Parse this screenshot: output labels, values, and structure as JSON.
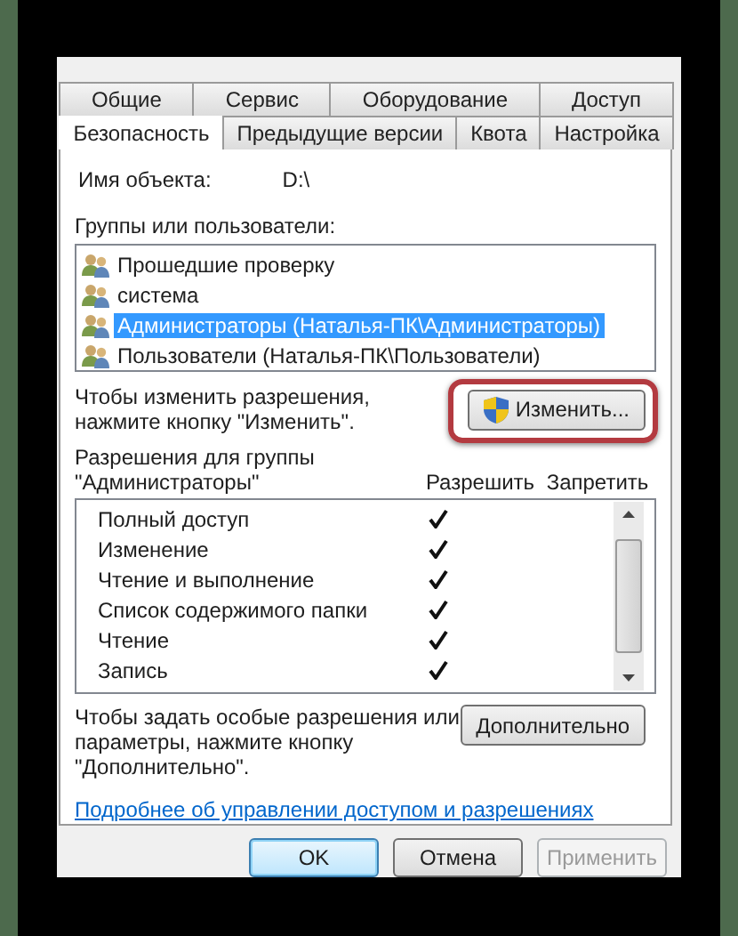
{
  "tabs_row_1": [
    {
      "label": "Общие",
      "selected": false
    },
    {
      "label": "Сервис",
      "selected": false
    },
    {
      "label": "Оборудование",
      "selected": false
    },
    {
      "label": "Доступ",
      "selected": false
    }
  ],
  "tabs_row_2": [
    {
      "label": "Безопасность",
      "selected": true
    },
    {
      "label": "Предыдущие версии",
      "selected": false
    },
    {
      "label": "Квота",
      "selected": false
    },
    {
      "label": "Настройка",
      "selected": false
    }
  ],
  "object_name": {
    "label": "Имя объекта:",
    "value": "D:\\"
  },
  "groups": {
    "label": "Группы или пользователи:",
    "items": [
      {
        "name": "Прошедшие проверку",
        "selected": false
      },
      {
        "name": "система",
        "selected": false
      },
      {
        "name": "Администраторы (Наталья-ПК\\Администраторы)",
        "selected": true
      },
      {
        "name": "Пользователи (Наталья-ПК\\Пользователи)",
        "selected": false
      }
    ]
  },
  "change_hint": "Чтобы изменить разрешения,\nнажмите кнопку \"Изменить\".",
  "change_button": {
    "label": "Изменить...",
    "highlighted": true
  },
  "permissions": {
    "label": "Разрешения для группы\n\"Администраторы\"",
    "allow_header": "Разрешить",
    "deny_header": "Запретить",
    "rows": [
      {
        "name": "Полный доступ",
        "allow": true,
        "deny": false
      },
      {
        "name": "Изменение",
        "allow": true,
        "deny": false
      },
      {
        "name": "Чтение и выполнение",
        "allow": true,
        "deny": false
      },
      {
        "name": "Список содержимого папки",
        "allow": true,
        "deny": false
      },
      {
        "name": "Чтение",
        "allow": true,
        "deny": false
      },
      {
        "name": "Запись",
        "allow": true,
        "deny": false
      }
    ]
  },
  "advanced_hint": "Чтобы задать особые разрешения или\nпараметры, нажмите кнопку\n\"Дополнительно\".",
  "advanced_button": "Дополнительно",
  "help_link": "Подробнее об управлении доступом и разрешениях",
  "buttons": [
    {
      "label": "OK",
      "kind": "default",
      "disabled": false
    },
    {
      "label": "Отмена",
      "kind": "normal",
      "disabled": false
    },
    {
      "label": "Применить",
      "kind": "normal",
      "disabled": true
    }
  ]
}
